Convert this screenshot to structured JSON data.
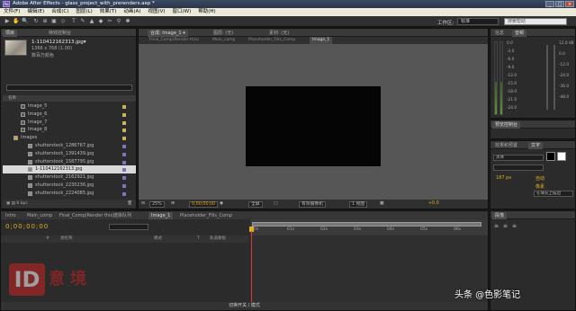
{
  "app": {
    "title": "Adobe After Effects - glass_project_with_prerenders.aep *",
    "icon": "Ae",
    "window_buttons": [
      "_",
      "□",
      "×"
    ]
  },
  "menu": [
    "文件(F)",
    "编辑(E)",
    "合成(C)",
    "图层(L)",
    "效果(T)",
    "动画(A)",
    "视图(V)",
    "窗口(W)",
    "帮助(H)"
  ],
  "toolbar": {
    "tools": [
      "▶",
      "✋",
      "🔍",
      "↻",
      "⊕",
      "▣",
      "◇",
      "T",
      "✎",
      "▲",
      "◆",
      "✂",
      "⚲",
      "✱"
    ],
    "workspace_label": "工作区:",
    "workspace_value": "标准",
    "search_placeholder": "搜索帮助"
  },
  "project": {
    "tabs": [
      "项目",
      "特效控制台"
    ],
    "selected_file": {
      "name": "1-110412162313.jpg▾",
      "dims": "1366 x 768 (1.00)",
      "colors": "数百万颜色"
    },
    "column_name": "名称",
    "rows": [
      {
        "name": "Image_5",
        "type": "comp",
        "indent": 1,
        "label": "#c9b25a"
      },
      {
        "name": "Image_6",
        "type": "comp",
        "indent": 1,
        "label": "#c9b25a"
      },
      {
        "name": "Image_7",
        "type": "comp",
        "indent": 1,
        "label": "#c9b25a"
      },
      {
        "name": "Image_8",
        "type": "comp",
        "indent": 1,
        "label": "#c9b25a"
      },
      {
        "name": "Images",
        "type": "folder",
        "indent": 0,
        "label": "#c9b25a"
      },
      {
        "name": "shutterstock_1286767.jpg",
        "type": "footage",
        "indent": 2,
        "label": "#7a76b8"
      },
      {
        "name": "shutterstock_1391439.jpg",
        "type": "footage",
        "indent": 2,
        "label": "#7a76b8"
      },
      {
        "name": "shutterstock_1587795.jpg",
        "type": "footage",
        "indent": 2,
        "label": "#7a76b8"
      },
      {
        "name": "1-110412162313.jpg",
        "type": "footage",
        "indent": 2,
        "label": "#7a76b8",
        "selected": true
      },
      {
        "name": "shutterstock_2162921.jpg",
        "type": "footage",
        "indent": 2,
        "label": "#7a76b8"
      },
      {
        "name": "shutterstock_2230236.jpg",
        "type": "footage",
        "indent": 2,
        "label": "#7a76b8"
      },
      {
        "name": "shutterstock_2224085.jpg",
        "type": "footage",
        "indent": 2,
        "label": "#7a76b8"
      }
    ],
    "bottom_bpc": "8 bpc"
  },
  "composition": {
    "tabs": [
      "合成: Image_1 ▾",
      "图层: (无)",
      "素材: (无)"
    ],
    "path": [
      "Final_Comp(Render this)",
      "Main_comp",
      "Placeholder_Fills_Comp",
      "Image_1"
    ],
    "zoom": "25%",
    "timecode": "0;00;00;00",
    "resolution": "全屏",
    "camera": "有效摄像机",
    "views": "1 视图",
    "exposure": "+0.0"
  },
  "info_audio": {
    "tabs": [
      "信息",
      "音频"
    ],
    "db_right": [
      "12.0 dB",
      "0.0",
      "-12.0",
      "-24.0",
      "-36.0",
      "-48.0"
    ],
    "db_left": [
      "0.0",
      "-3.0",
      "-6.0",
      "-9.0",
      "-12.0",
      "-15.0",
      "-18.0",
      "-21.0",
      "-24.0"
    ]
  },
  "preview": {
    "tab": "预览控制台"
  },
  "character": {
    "tabs": [
      "效果和预置",
      "文字"
    ],
    "font": "黑体",
    "size": "187 px",
    "size_auto": "自动",
    "units": "像素",
    "stroke": "在填充上描边"
  },
  "timeline": {
    "tabs": [
      "Intro",
      "Main_comp",
      "Final_Comp(Render this)",
      "渲染队列",
      "Image_1",
      "Placeholder_Fills_Comp"
    ],
    "active_tab": 4,
    "timecode": "0;00;00;00",
    "columns": [
      "#",
      "源名称",
      "模式",
      "T",
      "轨道蒙板"
    ],
    "ruler_ticks": [
      "0s",
      "01s",
      "02s",
      "03s",
      "04s",
      "05s",
      "06s"
    ],
    "bottom_label": "切换开关 / 模式"
  },
  "paragraph": {
    "tab": "段落"
  },
  "watermark": {
    "logo": "ID",
    "text": "意境",
    "credit": "头条 @色影笔记"
  },
  "colors": {
    "accent": "#e0b020",
    "cti": "#dd3333",
    "selected_row": "#d9d9d9"
  }
}
